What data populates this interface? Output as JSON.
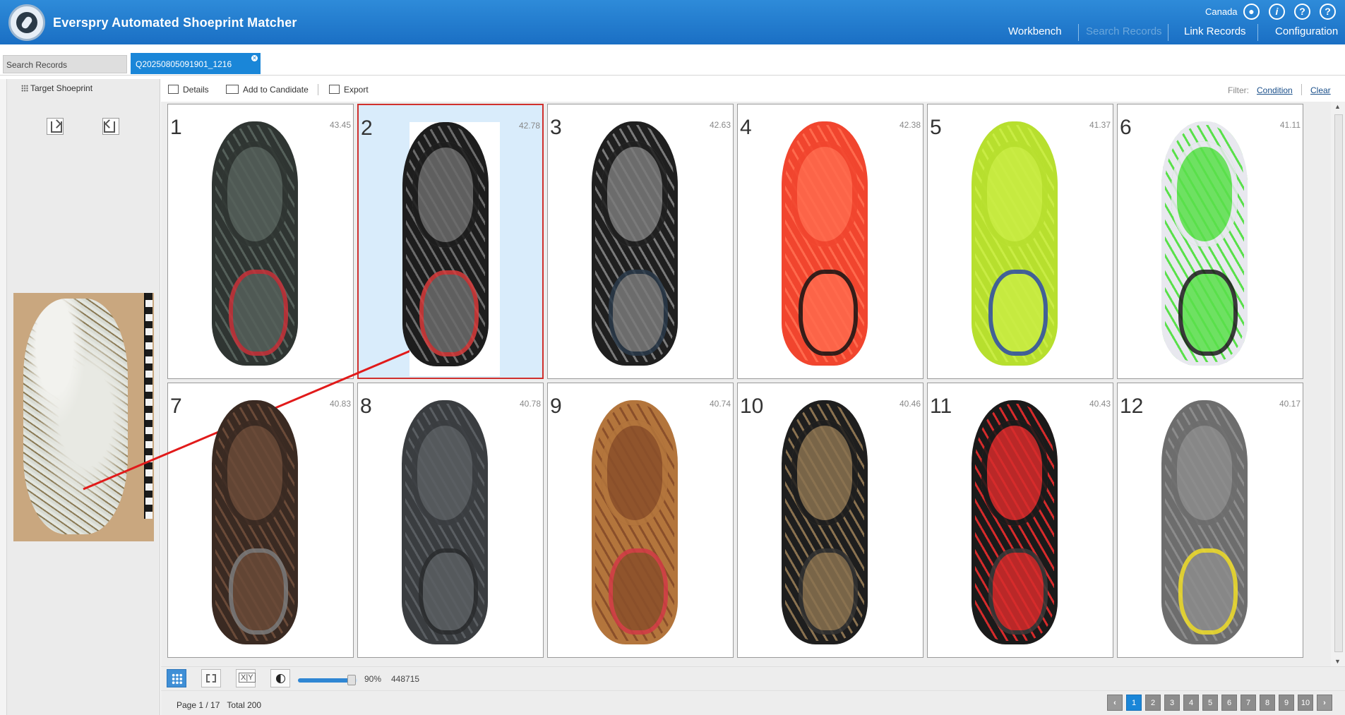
{
  "header": {
    "app_title": "Everspry Automated Shoeprint Matcher",
    "country": "Canada",
    "icons": [
      "user-icon",
      "info-icon",
      "help-icon",
      "help-icon"
    ],
    "nav": [
      {
        "label": "Workbench",
        "active": false
      },
      {
        "label": "Search Records",
        "active": true
      },
      {
        "label": "Link Records",
        "active": false
      },
      {
        "label": "Configuration",
        "active": false
      }
    ]
  },
  "tabs": {
    "search_tab": "Search Records",
    "query_tab": "Q20250805091901_1216"
  },
  "left_panel": {
    "title": "Target Shoeprint"
  },
  "toolbar": {
    "details": "Details",
    "add_to_candidate": "Add to Candidate",
    "export": "Export",
    "filter_label": "Filter:",
    "condition": "Condition",
    "clear": "Clear"
  },
  "results": [
    {
      "rank": "1",
      "score": "43.45",
      "colors": [
        "#2f3532",
        "#55605a",
        "#c8323a"
      ]
    },
    {
      "rank": "2",
      "score": "42.78",
      "colors": [
        "#1d1d1d",
        "#6b6b6b",
        "#d83b3b"
      ],
      "selected": true
    },
    {
      "rank": "3",
      "score": "42.63",
      "colors": [
        "#1f1f1f",
        "#7a7a7a",
        "#2a3a4a"
      ]
    },
    {
      "rank": "4",
      "score": "42.38",
      "colors": [
        "#f1452e",
        "#ff6a4d",
        "#151515"
      ]
    },
    {
      "rank": "5",
      "score": "41.37",
      "colors": [
        "#b7df2e",
        "#c9ec44",
        "#2d4aa8"
      ]
    },
    {
      "rank": "6",
      "score": "41.11",
      "colors": [
        "#e8e8ef",
        "#59e04a",
        "#1b1b1b"
      ]
    },
    {
      "rank": "7",
      "score": "40.83",
      "colors": [
        "#3a2a22",
        "#6a4a38",
        "#7d7d7d"
      ]
    },
    {
      "rank": "8",
      "score": "40.78",
      "colors": [
        "#3a3d40",
        "#5a5e62",
        "#2a2c2e"
      ]
    },
    {
      "rank": "9",
      "score": "40.74",
      "colors": [
        "#b3753c",
        "#8a4f2a",
        "#d23a46"
      ]
    },
    {
      "rank": "10",
      "score": "40.46",
      "colors": [
        "#1e1e1e",
        "#8a7250",
        "#333"
      ]
    },
    {
      "rank": "11",
      "score": "40.43",
      "colors": [
        "#1a1a1a",
        "#d62b2b",
        "#3a3a3a"
      ]
    },
    {
      "rank": "12",
      "score": "40.17",
      "colors": [
        "#6d6d6d",
        "#8c8c8c",
        "#f2df2a"
      ]
    }
  ],
  "bottom_bar": {
    "zoom_percent": 90,
    "zoom_label": "90%",
    "record_id": "448715"
  },
  "status": {
    "page_info": "Page 1 / 17",
    "total": "Total 200",
    "pages": [
      "1",
      "2",
      "3",
      "4",
      "5",
      "6",
      "7",
      "8",
      "9",
      "10"
    ],
    "current_page": "1"
  }
}
